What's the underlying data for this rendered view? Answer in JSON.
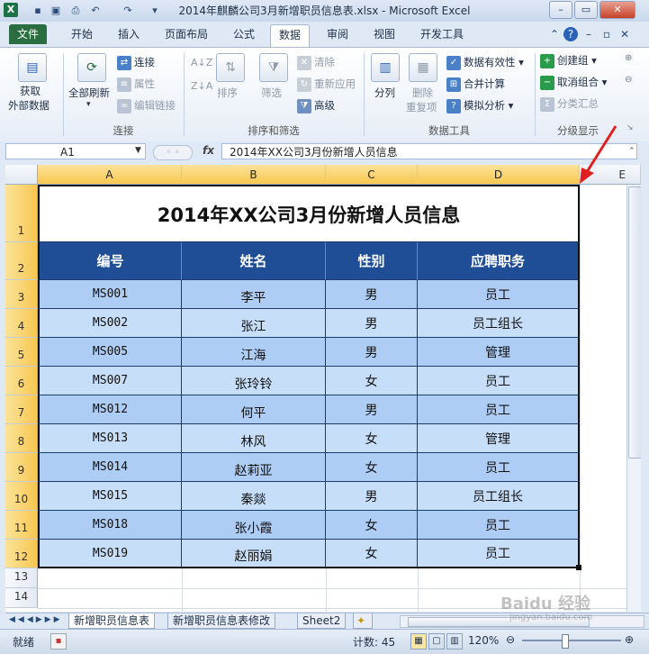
{
  "window": {
    "title": "2014年麒麟公司3月新增职员信息表.xlsx - Microsoft Excel",
    "app_icon": "X",
    "controls": [
      "–",
      "▭",
      "✕"
    ]
  },
  "quick_access": [
    "save-icon",
    "undo-icon",
    "redo-icon"
  ],
  "ribbon_tabs": [
    "文件",
    "开始",
    "插入",
    "页面布局",
    "公式",
    "数据",
    "审阅",
    "视图",
    "开发工具"
  ],
  "ribbon": {
    "get_external": "获取",
    "get_external2": "外部数据",
    "refresh_all": "全部刷新",
    "connections": "连接",
    "properties": "属性",
    "edit_links": "编辑链接",
    "group_connections": "连接",
    "sort": "排序",
    "filter": "筛选",
    "clear": "清除",
    "reapply": "重新应用",
    "advanced": "高级",
    "group_sort": "排序和筛选",
    "split": "分列",
    "remove_dup": "删除",
    "remove_dup2": "重复项",
    "validation": "数据有效性",
    "consolidate": "合并计算",
    "whatif": "模拟分析",
    "group_tools": "数据工具",
    "group": "创建组",
    "ungroup": "取消组合",
    "subtotal": "分类汇总",
    "group_outline": "分级显示"
  },
  "formula_bar": {
    "name_box": "A1",
    "fx": "fx",
    "content": "2014年XX公司3月份新增人员信息"
  },
  "columns": [
    "A",
    "B",
    "C",
    "D",
    "E"
  ],
  "rows": [
    "1",
    "2",
    "3",
    "4",
    "5",
    "6",
    "7",
    "8",
    "9",
    "10",
    "11",
    "12",
    "13",
    "14"
  ],
  "table": {
    "title": "2014年XX公司3月份新增人员信息",
    "headers": [
      "编号",
      "姓名",
      "性别",
      "应聘职务"
    ],
    "records": [
      [
        "MS001",
        "李平",
        "男",
        "员工"
      ],
      [
        "MS002",
        "张江",
        "男",
        "员工组长"
      ],
      [
        "MS005",
        "江海",
        "男",
        "管理"
      ],
      [
        "MS007",
        "张玲铃",
        "女",
        "员工"
      ],
      [
        "MS012",
        "何平",
        "男",
        "员工"
      ],
      [
        "MS013",
        "林风",
        "女",
        "管理"
      ],
      [
        "MS014",
        "赵莉亚",
        "女",
        "员工"
      ],
      [
        "MS015",
        "秦燚",
        "男",
        "员工组长"
      ],
      [
        "MS018",
        "张小霞",
        "女",
        "员工"
      ],
      [
        "MS019",
        "赵丽娟",
        "女",
        "员工"
      ]
    ]
  },
  "sheet_tabs": [
    "新增职员信息表",
    "新增职员信息表修改",
    "Sheet2"
  ],
  "status": {
    "ready": "就绪",
    "count": "计数: 45",
    "zoom": "120%",
    "watermark": "Baidu 经验",
    "watermark_sub": "jingyan.baidu.com"
  },
  "colors": {
    "header_fill": "#1f4e96",
    "row_odd": "#aecdf5",
    "row_even": "#c7def9",
    "file_tab": "#2a6e3f",
    "arrow": "#e02020"
  }
}
